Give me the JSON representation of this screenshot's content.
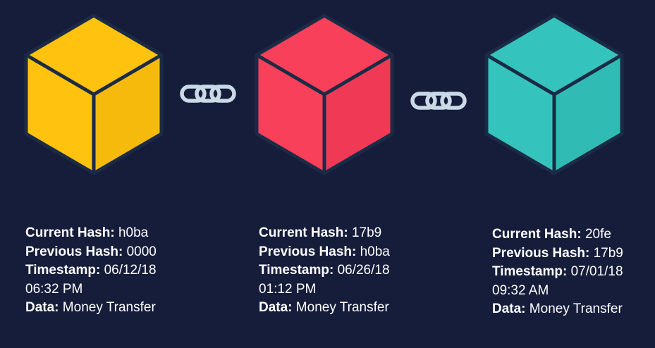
{
  "colors": {
    "background": "#161d3b",
    "outline": "#1b2b45",
    "chain": "#c9d9e6"
  },
  "blocks": [
    {
      "color_top": "#ffc20e",
      "color_left": "#ffc20e",
      "color_right": "#f5ba0c",
      "current_hash_label": "Current Hash:",
      "current_hash": "h0ba",
      "previous_hash_label": "Previous Hash:",
      "previous_hash": "0000",
      "timestamp_label": "Timestamp:",
      "timestamp_date": "06/12/18",
      "timestamp_time": "06:32 PM",
      "data_label": "Data:",
      "data": "Money Transfer"
    },
    {
      "color_top": "#f9405b",
      "color_left": "#f9405b",
      "color_right": "#f03a55",
      "current_hash_label": "Current Hash:",
      "current_hash": "17b9",
      "previous_hash_label": "Previous Hash:",
      "previous_hash": "h0ba",
      "timestamp_label": "Timestamp:",
      "timestamp_date": "06/26/18",
      "timestamp_time": "01:12 PM",
      "data_label": "Data:",
      "data": "Money Transfer"
    },
    {
      "color_top": "#35c4bd",
      "color_left": "#35c4bd",
      "color_right": "#30bbb4",
      "current_hash_label": "Current Hash:",
      "current_hash": "20fe",
      "previous_hash_label": "Previous Hash:",
      "previous_hash": "17b9",
      "timestamp_label": "Timestamp:",
      "timestamp_date": "07/01/18",
      "timestamp_time": "09:32 AM",
      "data_label": "Data:",
      "data": "Money Transfer"
    }
  ]
}
